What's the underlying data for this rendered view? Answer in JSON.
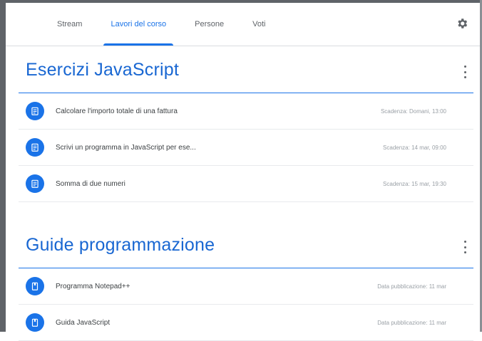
{
  "tabs": [
    {
      "label": "Stream"
    },
    {
      "label": "Lavori del corso"
    },
    {
      "label": "Persone"
    },
    {
      "label": "Voti"
    }
  ],
  "active_tab": "Lavori del corso",
  "colors": {
    "accent": "#1a73e8",
    "title": "#1967d2"
  },
  "sections": [
    {
      "title": "Esercizi JavaScript",
      "items": [
        {
          "icon": "assignment-icon",
          "title": "Calcolare l'importo totale di una fattura",
          "meta": "Scadenza: Domani, 13:00"
        },
        {
          "icon": "assignment-icon",
          "title": "Scrivi un programma in JavaScript per ese...",
          "meta": "Scadenza: 14 mar, 09:00"
        },
        {
          "icon": "assignment-icon",
          "title": "Somma di due numeri",
          "meta": "Scadenza: 15 mar, 19:30"
        }
      ]
    },
    {
      "title": "Guide programmazione",
      "items": [
        {
          "icon": "material-icon",
          "title": "Programma Notepad++",
          "meta": "Data pubblicazione: 11 mar"
        },
        {
          "icon": "material-icon",
          "title": "Guida JavaScript",
          "meta": "Data pubblicazione: 11 mar"
        }
      ]
    }
  ]
}
